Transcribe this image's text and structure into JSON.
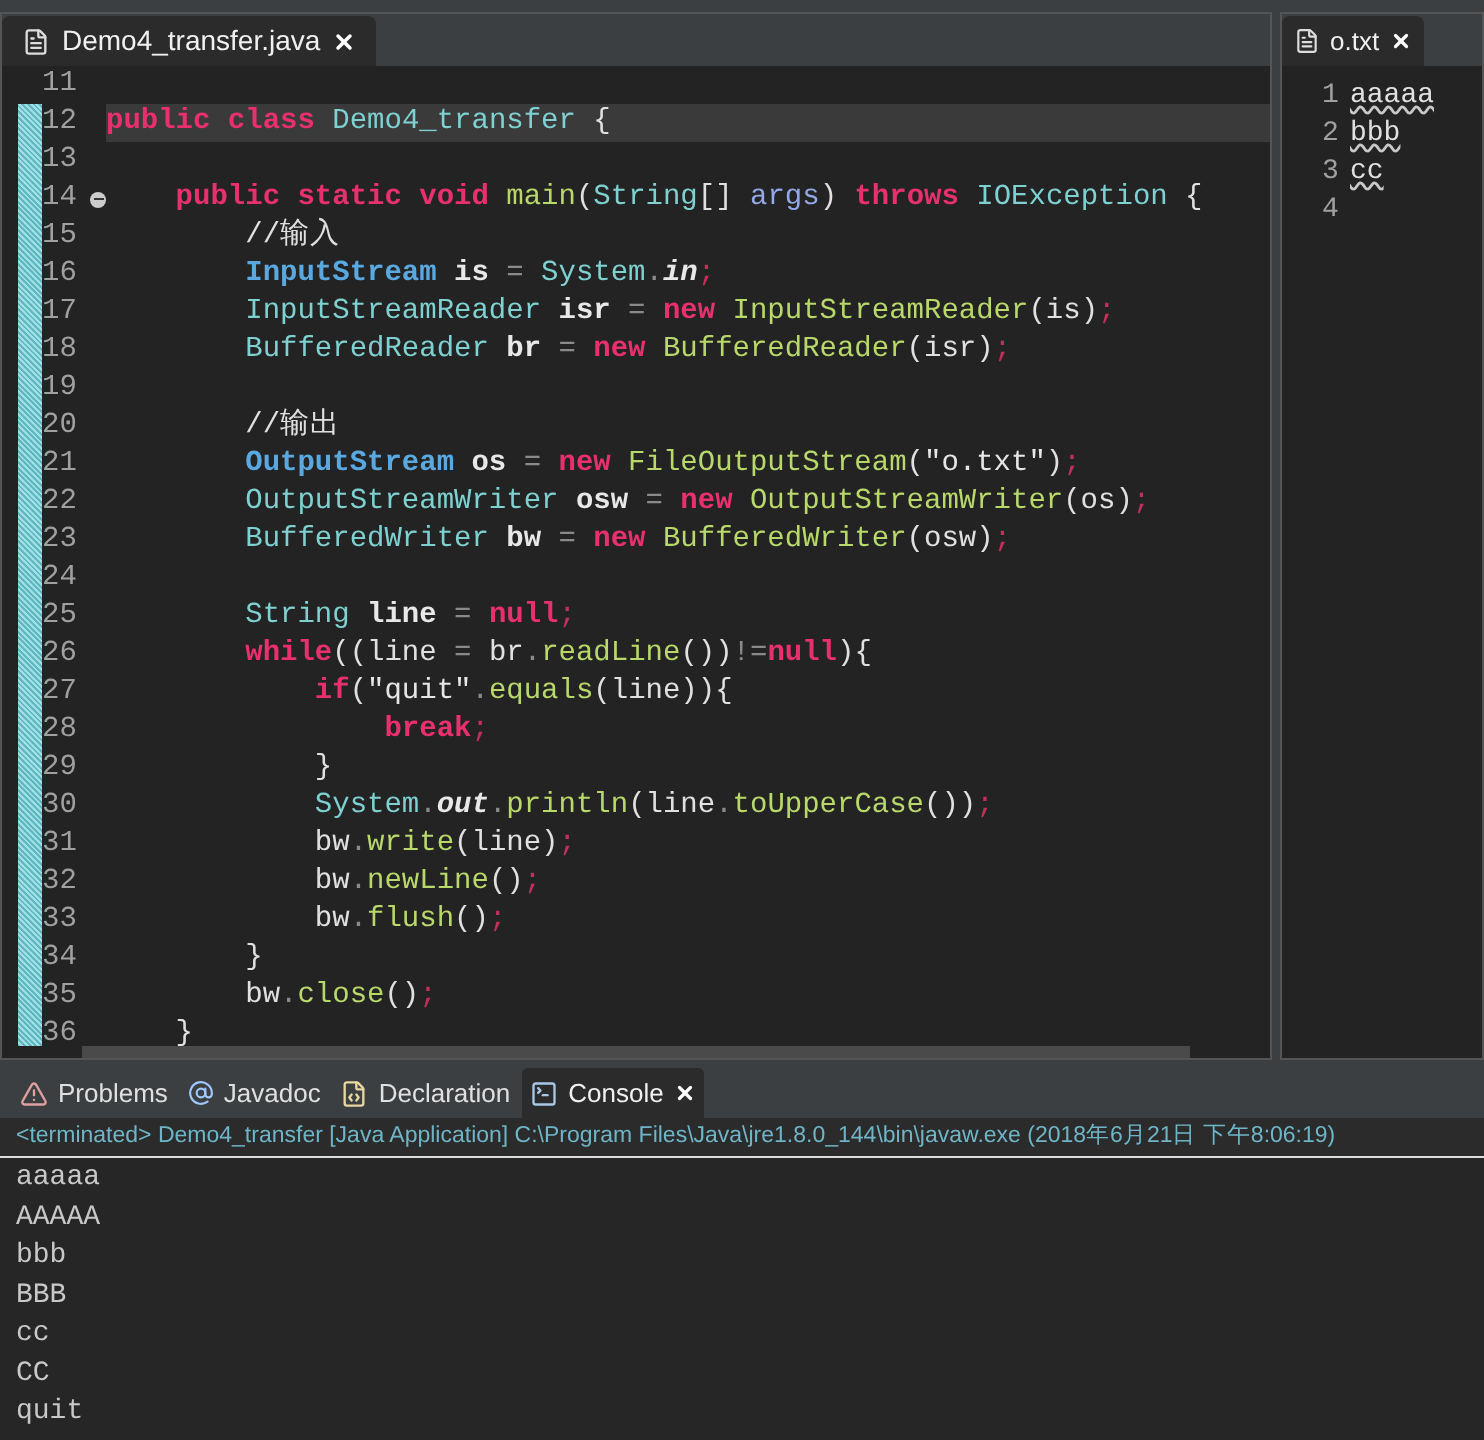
{
  "editor": {
    "tab": {
      "label": "Demo4_transfer.java",
      "selected": true
    },
    "lines": [
      {
        "number": "11"
      },
      {
        "number": "12",
        "current": true,
        "tokens": [
          {
            "kind": "kw",
            "text": "public"
          },
          {
            "kind": "kw",
            "text": " class"
          },
          {
            "kind": "type",
            "text": " Demo4_transfer"
          },
          {
            "kind": "plain",
            "text": " {"
          }
        ]
      },
      {
        "number": "13"
      },
      {
        "number": "14",
        "expanded": true,
        "tokens": [
          {
            "kind": "kw",
            "text": "    public"
          },
          {
            "kind": "kw",
            "text": " static"
          },
          {
            "kind": "kw",
            "text": " void"
          },
          {
            "kind": "method",
            "text": " main"
          },
          {
            "kind": "plain",
            "text": "("
          },
          {
            "kind": "type",
            "text": "String"
          },
          {
            "kind": "plain",
            "text": "[]"
          },
          {
            "kind": "param",
            "text": " args"
          },
          {
            "kind": "plain",
            "text": ")"
          },
          {
            "kind": "kw",
            "text": " throws"
          },
          {
            "kind": "type",
            "text": " IOException"
          },
          {
            "kind": "plain",
            "text": " {"
          }
        ]
      },
      {
        "number": "15",
        "tokens": [
          {
            "kind": "comment",
            "text": "        //输入"
          }
        ]
      },
      {
        "number": "16",
        "tokens": [
          {
            "kind": "type2",
            "text": "        InputStream"
          },
          {
            "kind": "var",
            "text": " is"
          },
          {
            "kind": "op",
            "text": " ="
          },
          {
            "kind": "type",
            "text": " System"
          },
          {
            "kind": "op",
            "text": "."
          },
          {
            "kind": "static",
            "text": "in"
          },
          {
            "kind": "semi",
            "text": ";"
          }
        ]
      },
      {
        "number": "17",
        "tokens": [
          {
            "kind": "type",
            "text": "        InputStreamReader"
          },
          {
            "kind": "var",
            "text": " isr"
          },
          {
            "kind": "op",
            "text": " ="
          },
          {
            "kind": "kw",
            "text": " new"
          },
          {
            "kind": "method",
            "text": " InputStreamReader"
          },
          {
            "kind": "plain",
            "text": "(is)"
          },
          {
            "kind": "semi",
            "text": ";"
          }
        ]
      },
      {
        "number": "18",
        "tokens": [
          {
            "kind": "type",
            "text": "        BufferedReader"
          },
          {
            "kind": "var",
            "text": " br"
          },
          {
            "kind": "op",
            "text": " ="
          },
          {
            "kind": "kw",
            "text": " new"
          },
          {
            "kind": "method",
            "text": " BufferedReader"
          },
          {
            "kind": "plain",
            "text": "(isr)"
          },
          {
            "kind": "semi",
            "text": ";"
          }
        ]
      },
      {
        "number": "19"
      },
      {
        "number": "20",
        "tokens": [
          {
            "kind": "comment",
            "text": "        //输出"
          }
        ]
      },
      {
        "number": "21",
        "tokens": [
          {
            "kind": "type2",
            "text": "        OutputStream"
          },
          {
            "kind": "var",
            "text": " os"
          },
          {
            "kind": "op",
            "text": " ="
          },
          {
            "kind": "kw",
            "text": " new"
          },
          {
            "kind": "method",
            "text": " FileOutputStream"
          },
          {
            "kind": "plain",
            "text": "("
          },
          {
            "kind": "str",
            "text": "\"o.txt\""
          },
          {
            "kind": "plain",
            "text": ")"
          },
          {
            "kind": "semi",
            "text": ";"
          }
        ]
      },
      {
        "number": "22",
        "tokens": [
          {
            "kind": "type",
            "text": "        OutputStreamWriter"
          },
          {
            "kind": "var",
            "text": " osw"
          },
          {
            "kind": "op",
            "text": " ="
          },
          {
            "kind": "kw",
            "text": " new"
          },
          {
            "kind": "method",
            "text": " OutputStreamWriter"
          },
          {
            "kind": "plain",
            "text": "(os)"
          },
          {
            "kind": "semi",
            "text": ";"
          }
        ]
      },
      {
        "number": "23",
        "tokens": [
          {
            "kind": "type",
            "text": "        BufferedWriter"
          },
          {
            "kind": "var",
            "text": " bw"
          },
          {
            "kind": "op",
            "text": " ="
          },
          {
            "kind": "kw",
            "text": " new"
          },
          {
            "kind": "method",
            "text": " BufferedWriter"
          },
          {
            "kind": "plain",
            "text": "(osw)"
          },
          {
            "kind": "semi",
            "text": ";"
          }
        ]
      },
      {
        "number": "24"
      },
      {
        "number": "25",
        "tokens": [
          {
            "kind": "type",
            "text": "        String"
          },
          {
            "kind": "var",
            "text": " line"
          },
          {
            "kind": "op",
            "text": " ="
          },
          {
            "kind": "kw",
            "text": " null"
          },
          {
            "kind": "semi",
            "text": ";"
          }
        ]
      },
      {
        "number": "26",
        "tokens": [
          {
            "kind": "kw",
            "text": "        while"
          },
          {
            "kind": "plain",
            "text": "((line"
          },
          {
            "kind": "op",
            "text": " ="
          },
          {
            "kind": "plain",
            "text": " br"
          },
          {
            "kind": "op",
            "text": "."
          },
          {
            "kind": "method",
            "text": "readLine"
          },
          {
            "kind": "plain",
            "text": "())"
          },
          {
            "kind": "op",
            "text": "!="
          },
          {
            "kind": "kw",
            "text": "null"
          },
          {
            "kind": "plain",
            "text": "){"
          }
        ]
      },
      {
        "number": "27",
        "tokens": [
          {
            "kind": "kw",
            "text": "            if"
          },
          {
            "kind": "plain",
            "text": "("
          },
          {
            "kind": "str",
            "text": "\"quit\""
          },
          {
            "kind": "op",
            "text": "."
          },
          {
            "kind": "method",
            "text": "equals"
          },
          {
            "kind": "plain",
            "text": "(line)){"
          }
        ]
      },
      {
        "number": "28",
        "tokens": [
          {
            "kind": "kw",
            "text": "                break"
          },
          {
            "kind": "semi",
            "text": ";"
          }
        ]
      },
      {
        "number": "29",
        "tokens": [
          {
            "kind": "plain",
            "text": "            }"
          }
        ]
      },
      {
        "number": "30",
        "tokens": [
          {
            "kind": "type",
            "text": "            System"
          },
          {
            "kind": "op",
            "text": "."
          },
          {
            "kind": "static",
            "text": "out"
          },
          {
            "kind": "op",
            "text": "."
          },
          {
            "kind": "method",
            "text": "println"
          },
          {
            "kind": "plain",
            "text": "(line"
          },
          {
            "kind": "op",
            "text": "."
          },
          {
            "kind": "method",
            "text": "toUpperCase"
          },
          {
            "kind": "plain",
            "text": "())"
          },
          {
            "kind": "semi",
            "text": ";"
          }
        ]
      },
      {
        "number": "31",
        "tokens": [
          {
            "kind": "plain",
            "text": "            bw"
          },
          {
            "kind": "op",
            "text": "."
          },
          {
            "kind": "method",
            "text": "write"
          },
          {
            "kind": "plain",
            "text": "(line)"
          },
          {
            "kind": "semi",
            "text": ";"
          }
        ]
      },
      {
        "number": "32",
        "tokens": [
          {
            "kind": "plain",
            "text": "            bw"
          },
          {
            "kind": "op",
            "text": "."
          },
          {
            "kind": "method",
            "text": "newLine"
          },
          {
            "kind": "plain",
            "text": "()"
          },
          {
            "kind": "semi",
            "text": ";"
          }
        ]
      },
      {
        "number": "33",
        "tokens": [
          {
            "kind": "plain",
            "text": "            bw"
          },
          {
            "kind": "op",
            "text": "."
          },
          {
            "kind": "method",
            "text": "flush"
          },
          {
            "kind": "plain",
            "text": "()"
          },
          {
            "kind": "semi",
            "text": ";"
          }
        ]
      },
      {
        "number": "34",
        "tokens": [
          {
            "kind": "plain",
            "text": "        }"
          }
        ]
      },
      {
        "number": "35",
        "tokens": [
          {
            "kind": "plain",
            "text": "        bw"
          },
          {
            "kind": "op",
            "text": "."
          },
          {
            "kind": "method",
            "text": "close"
          },
          {
            "kind": "plain",
            "text": "()"
          },
          {
            "kind": "semi",
            "text": ";"
          }
        ]
      },
      {
        "number": "36",
        "tokens": [
          {
            "kind": "plain",
            "text": "    }"
          }
        ]
      }
    ]
  },
  "text_editor": {
    "tab": {
      "label": "o.txt",
      "selected": true
    },
    "lines": [
      {
        "number": "1",
        "text": "aaaaa",
        "misspelled": true
      },
      {
        "number": "2",
        "text": "bbb",
        "misspelled": true
      },
      {
        "number": "3",
        "text": "cc",
        "misspelled": true
      },
      {
        "number": "4"
      }
    ]
  },
  "bottom_panel": {
    "tabs": [
      {
        "label": "Problems",
        "kind": "problems",
        "selected": false
      },
      {
        "label": "Javadoc",
        "kind": "javadoc",
        "selected": false
      },
      {
        "label": "Declaration",
        "kind": "declaration",
        "selected": false
      },
      {
        "label": "Console",
        "kind": "console",
        "selected": true
      }
    ],
    "status": "<terminated> Demo4_transfer [Java Application] C:\\Program Files\\Java\\jre1.8.0_144\\bin\\javaw.exe (2018年6月21日 下午8:06:19)",
    "output": [
      "aaaaa",
      "AAAAA",
      "bbb",
      "BBB",
      "cc",
      "CC",
      "quit"
    ]
  }
}
